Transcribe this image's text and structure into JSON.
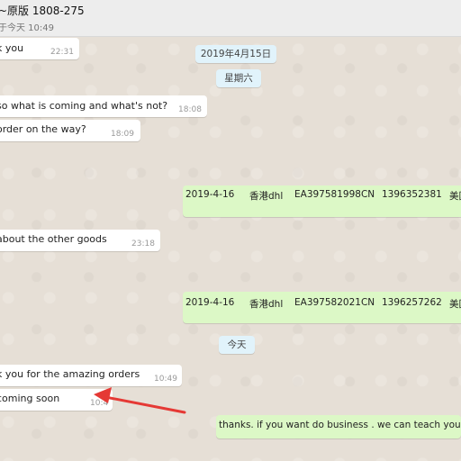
{
  "header": {
    "title": "~原版 1808-275",
    "subtitle": "于今天 10:49"
  },
  "dates": {
    "date_1": "2019年4月15日",
    "day_1": "星期六",
    "today": "今天"
  },
  "messages": [
    {
      "text": "k you",
      "time": "22:31"
    },
    {
      "text": "so what is coming and what's not?",
      "time": "18:08"
    },
    {
      "text": " order on the way?",
      "time": "18:09"
    },
    {
      "text": " about the other goods",
      "time": "23:18"
    },
    {
      "text": "k you for the amazing orders",
      "time": "10:49"
    },
    {
      "text": " coming soon",
      "time": "10:4"
    },
    {
      "text": "thanks. if you want do business . we can teach you .",
      "time": ""
    }
  ],
  "shipments": [
    {
      "date": "2019-4-16",
      "carrier": "香港dhl",
      "tracking": "EA397581998CN",
      "phone": "1396352381",
      "dest": "美国"
    },
    {
      "date": "2019-4-16",
      "carrier": "香港dhl",
      "tracking": "EA397582021CN",
      "phone": "1396257262",
      "dest": "美国"
    }
  ],
  "colors": {
    "incoming_bubble": "#ffffff",
    "outgoing_bubble": "#dcf8c6",
    "date_pill": "#e1f3fb",
    "annotation_arrow": "#e53935"
  }
}
